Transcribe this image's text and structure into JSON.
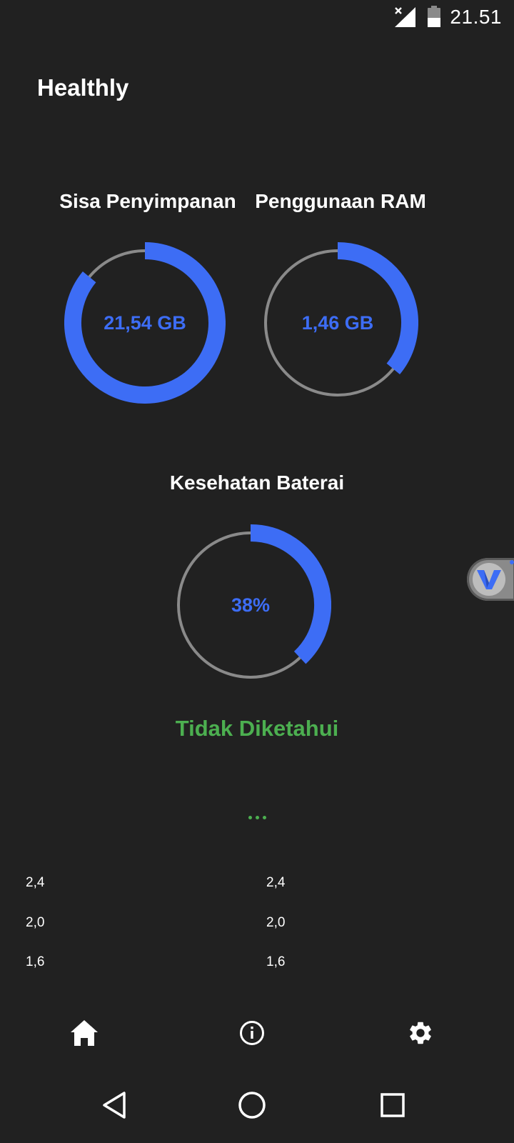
{
  "status_bar": {
    "time": "21.51",
    "signal_icon": "signal-no-service-icon",
    "battery_icon": "battery-half-icon"
  },
  "app": {
    "title": "Healthly"
  },
  "storage": {
    "title": "Sisa Penyimpanan",
    "value": "21,54 GB",
    "fill_fraction": 0.86
  },
  "ram": {
    "title": "Penggunaan RAM",
    "value": "1,46 GB",
    "fill_fraction": 0.36
  },
  "battery": {
    "title": "Kesehatan Baterai",
    "value": "38%",
    "fill_fraction": 0.38,
    "status": "Tidak Diketahui"
  },
  "charts": {
    "left_axis": [
      "2,4",
      "2,0",
      "1,6"
    ],
    "right_axis": [
      "2,4",
      "2,0",
      "1,6"
    ]
  },
  "bottom_nav": {
    "items": [
      {
        "icon": "home-icon",
        "active": true
      },
      {
        "icon": "info-icon",
        "active": false
      },
      {
        "icon": "settings-gear-icon",
        "active": false
      }
    ]
  },
  "system_nav": {
    "back_icon": "back-triangle-icon",
    "home_icon": "home-circle-icon",
    "recents_icon": "recents-square-icon"
  },
  "colors": {
    "background": "#212121",
    "accent": "#3d6df5",
    "track": "#8a8a8a",
    "status_green": "#4caf50"
  }
}
